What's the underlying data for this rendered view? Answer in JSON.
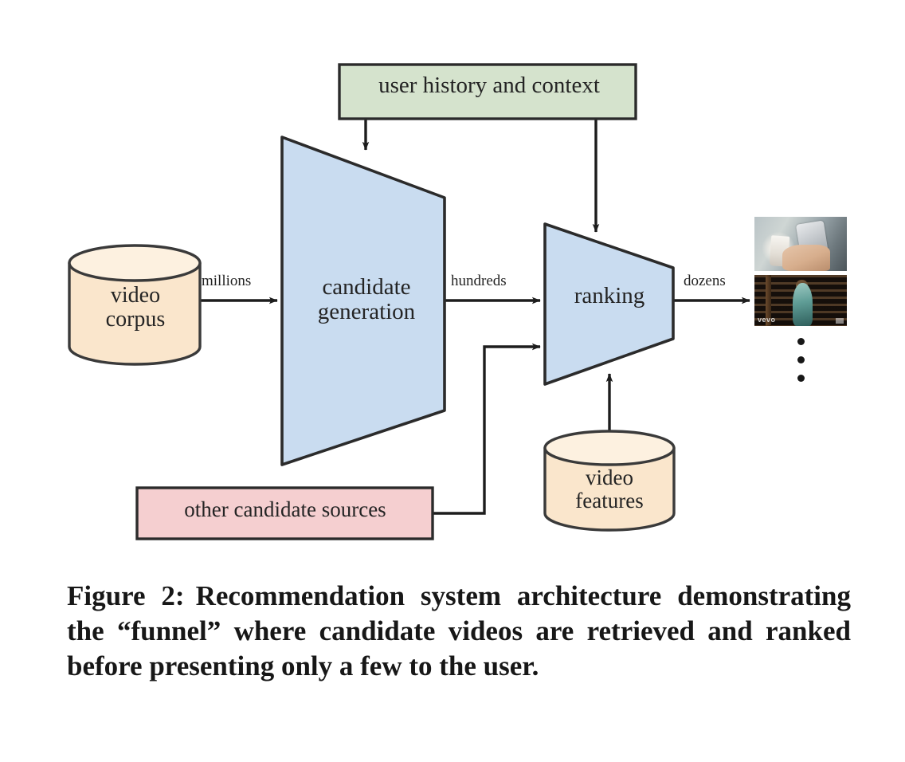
{
  "figure": {
    "caption_label": "Figure 2:",
    "caption_text": "Recommendation system architecture demonstrating the “funnel” where candidate videos are retrieved and ranked before presenting only a few to the user."
  },
  "nodes": {
    "user_history": {
      "label": "user history and context",
      "shape": "rectangle",
      "fill": "#d5e3cd",
      "stroke": "#2b2b2b"
    },
    "video_corpus": {
      "label_line1": "video",
      "label_line2": "corpus",
      "shape": "cylinder",
      "fill": "#fae6cc",
      "stroke": "#3a3a3a"
    },
    "candidate_generation": {
      "label_line1": "candidate",
      "label_line2": "generation",
      "shape": "trapezoid",
      "fill": "#c9dcf0",
      "stroke": "#2b2b2b"
    },
    "ranking": {
      "label": "ranking",
      "shape": "trapezoid",
      "fill": "#c9dcf0",
      "stroke": "#2b2b2b"
    },
    "other_candidate_sources": {
      "label": "other candidate sources",
      "shape": "rectangle",
      "fill": "#f5cfd0",
      "stroke": "#2b2b2b"
    },
    "video_features": {
      "label_line1": "video",
      "label_line2": "features",
      "shape": "cylinder",
      "fill": "#fae6cc",
      "stroke": "#3a3a3a"
    }
  },
  "edges": [
    {
      "id": "corpus-to-candgen",
      "label": "millions",
      "from": "video_corpus",
      "to": "candidate_generation"
    },
    {
      "id": "candgen-to-ranking",
      "label": "hundreds",
      "from": "candidate_generation",
      "to": "ranking"
    },
    {
      "id": "ranking-to-results",
      "label": "dozens",
      "from": "ranking",
      "to": "results"
    },
    {
      "id": "history-to-candgen",
      "label": "",
      "from": "user_history",
      "to": "candidate_generation"
    },
    {
      "id": "history-to-ranking",
      "label": "",
      "from": "user_history",
      "to": "ranking"
    },
    {
      "id": "othersources-to-ranking",
      "label": "",
      "from": "other_candidate_sources",
      "to": "ranking"
    },
    {
      "id": "features-to-ranking",
      "label": "",
      "from": "video_features",
      "to": "ranking"
    }
  ],
  "results": {
    "thumbnails": [
      {
        "name": "hands-holding-phone-and-coffee-photo",
        "watermark": ""
      },
      {
        "name": "dark-music-video-thumbnail",
        "watermark": "vevo"
      }
    ],
    "ellipsis_dot_count": 3
  },
  "colors": {
    "green_fill": "#d5e3cd",
    "blue_fill": "#c9dcf0",
    "peach_fill": "#fae6cc",
    "pink_fill": "#f5cfd0",
    "line": "#222222",
    "background": "#ffffff"
  }
}
